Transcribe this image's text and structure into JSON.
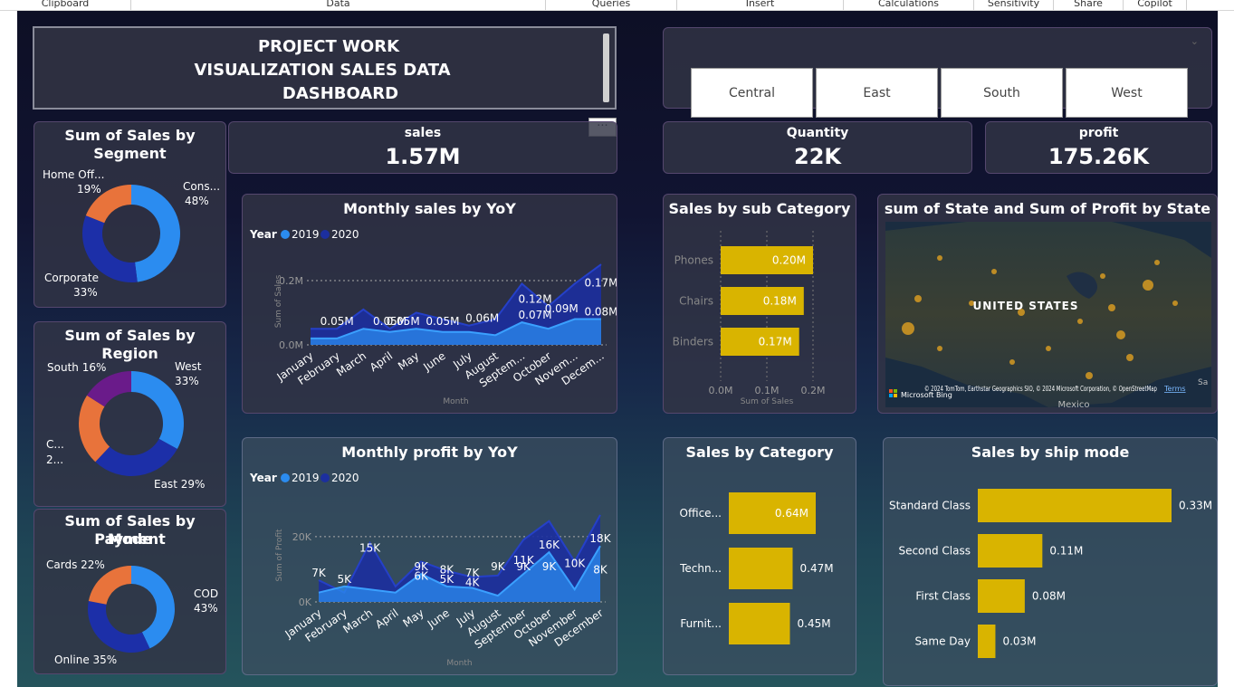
{
  "ribbon": {
    "groups": [
      "Clipboard",
      "Data",
      "Queries",
      "Insert",
      "Calculations",
      "Sensitivity",
      "Share",
      "Copilot"
    ]
  },
  "header": {
    "line1": "PROJECT WORK",
    "line2": "VISUALIZATION SALES DATA",
    "line3": "DASHBOARD"
  },
  "slicer": {
    "options": [
      "Central",
      "East",
      "South",
      "West"
    ]
  },
  "kpis": {
    "sales": {
      "label": "sales",
      "value": "1.57M"
    },
    "quantity": {
      "label": "Quantity",
      "value": "22K"
    },
    "profit": {
      "label": "profit",
      "value": "175.26K"
    }
  },
  "donut_segment": {
    "title_l1": "Sum of Sales by",
    "title_l2": "Segment",
    "slices": [
      {
        "name": "Cons...",
        "pct": "48%",
        "value": 48,
        "color": "#2b8cf0"
      },
      {
        "name": "Corporate",
        "pct": "33%",
        "value": 33,
        "color": "#1c2fa8"
      },
      {
        "name": "Home Off...",
        "pct": "19%",
        "value": 19,
        "color": "#e8733b"
      }
    ]
  },
  "donut_region": {
    "title": "Sum of Sales by Region",
    "slices": [
      {
        "name": "West",
        "pct": "33%",
        "value": 33,
        "color": "#2b8cf0"
      },
      {
        "name": "East",
        "pct": "29%",
        "value": 29,
        "color": "#1c2fa8"
      },
      {
        "name": "C...",
        "pct": "2...",
        "value": 22,
        "color": "#e8733b"
      },
      {
        "name": "South",
        "pct": "16%",
        "value": 16,
        "color": "#6a1b8a"
      }
    ],
    "labels": {
      "west": "West",
      "west_pct": "33%",
      "east": "East 29%",
      "south": "South 16%",
      "c1": "C...",
      "c2": "2..."
    }
  },
  "donut_payment": {
    "title_l1": "Sum of Sales by Payment",
    "title_l2": "Mode",
    "slices": [
      {
        "name": "COD",
        "pct": "43%",
        "value": 43,
        "color": "#2b8cf0"
      },
      {
        "name": "Online",
        "pct": "35%",
        "value": 35,
        "color": "#1c2fa8"
      },
      {
        "name": "Cards",
        "pct": "22%",
        "value": 22,
        "color": "#e8733b"
      }
    ],
    "labels": {
      "cards": "Cards 22%",
      "cod": "COD",
      "cod_pct": "43%",
      "online": "Online 35%"
    }
  },
  "months_sales": [
    "January",
    "February",
    "March",
    "April",
    "May",
    "June",
    "July",
    "August",
    "Septem...",
    "October",
    "Novem...",
    "Decem..."
  ],
  "months_profit": [
    "January",
    "February",
    "March",
    "April",
    "May",
    "June",
    "July",
    "August",
    "September",
    "October",
    "November",
    "December"
  ],
  "chart_data": [
    {
      "type": "area",
      "title": "Monthly sales by YoY",
      "legend_title": "Year",
      "xlabel": "Month",
      "ylabel": "Sum of Sales",
      "yticks": [
        "0.0M",
        "0.2M"
      ],
      "ylim": [
        0,
        0.27
      ],
      "series": [
        {
          "name": "2020",
          "color": "#1c2f9e",
          "values": [
            0.05,
            0.05,
            0.11,
            0.05,
            0.1,
            0.08,
            0.06,
            0.08,
            0.19,
            0.12,
            0.19,
            0.25
          ]
        },
        {
          "name": "2019",
          "color": "#2b8cf0",
          "values": [
            0.02,
            0.02,
            0.05,
            0.04,
            0.05,
            0.04,
            0.04,
            0.03,
            0.07,
            0.05,
            0.08,
            0.08
          ]
        }
      ],
      "data_labels": [
        {
          "text": "0.05M",
          "x": 1,
          "y": 0.05
        },
        {
          "text": "0.05M",
          "x": 3,
          "y": 0.05
        },
        {
          "text": "0.05M",
          "x": 3.5,
          "y": 0.05
        },
        {
          "text": "0.05M",
          "x": 5,
          "y": 0.05
        },
        {
          "text": "0.06M",
          "x": 6.5,
          "y": 0.06
        },
        {
          "text": "0.12M",
          "x": 8.5,
          "y": 0.12
        },
        {
          "text": "0.07M",
          "x": 8.5,
          "y": 0.07
        },
        {
          "text": "0.09M",
          "x": 9.5,
          "y": 0.09
        },
        {
          "text": "0.17M",
          "x": 11,
          "y": 0.17
        },
        {
          "text": "0.08M",
          "x": 11,
          "y": 0.08
        }
      ]
    },
    {
      "type": "area",
      "title": "Monthly profit by YoY",
      "legend_title": "Year",
      "xlabel": "Month",
      "ylabel": "Sum of Profit",
      "yticks": [
        "0K",
        "20K"
      ],
      "ylim": [
        0,
        30000
      ],
      "series": [
        {
          "name": "2020",
          "color": "#1c2f9e",
          "values": [
            7000,
            3000,
            19000,
            5000,
            13000,
            10000,
            8000,
            8500,
            20000,
            26000,
            13000,
            28000
          ]
        },
        {
          "name": "2019",
          "color": "#2b8cf0",
          "values": [
            3000,
            5000,
            4000,
            3000,
            9000,
            5000,
            4500,
            2000,
            9000,
            16000,
            4000,
            18000
          ]
        }
      ],
      "data_labels": [
        {
          "text": "7K",
          "x": 0,
          "y": 7000
        },
        {
          "text": "5K",
          "x": 1,
          "y": 5000
        },
        {
          "text": "15K",
          "x": 2,
          "y": 15000
        },
        {
          "text": "6K",
          "x": 4,
          "y": 6000
        },
        {
          "text": "9K",
          "x": 4,
          "y": 9000
        },
        {
          "text": "8K",
          "x": 5,
          "y": 8000
        },
        {
          "text": "5K",
          "x": 5,
          "y": 5000
        },
        {
          "text": "7K",
          "x": 6,
          "y": 7000
        },
        {
          "text": "4K",
          "x": 6,
          "y": 4000
        },
        {
          "text": "9K",
          "x": 7,
          "y": 9000
        },
        {
          "text": "11K",
          "x": 8,
          "y": 11000
        },
        {
          "text": "9K",
          "x": 8,
          "y": 9000
        },
        {
          "text": "9K",
          "x": 9,
          "y": 9000
        },
        {
          "text": "16K",
          "x": 9,
          "y": 16000
        },
        {
          "text": "10K",
          "x": 10,
          "y": 10000
        },
        {
          "text": "8K",
          "x": 11,
          "y": 8000
        },
        {
          "text": "18K",
          "x": 11,
          "y": 18000
        }
      ]
    },
    {
      "type": "bar",
      "title": "Sales by sub Category",
      "xlabel": "Sum of Sales",
      "xticks": [
        "0.0M",
        "0.1M",
        "0.2M"
      ],
      "xlim": [
        0,
        0.2
      ],
      "categories": [
        "Phones",
        "Chairs",
        "Binders"
      ],
      "values": [
        0.2,
        0.18,
        0.17
      ],
      "value_labels": [
        "0.20M",
        "0.18M",
        "0.17M"
      ],
      "color": "#d9b400"
    },
    {
      "type": "bar",
      "title": "Sales by Category",
      "categories": [
        "Office...",
        "Techn...",
        "Furnit..."
      ],
      "values": [
        0.64,
        0.47,
        0.45
      ],
      "value_labels": [
        "0.64M",
        "0.47M",
        "0.45M"
      ],
      "xlim": [
        0,
        0.64
      ],
      "color": "#d9b400"
    },
    {
      "type": "bar",
      "title": "Sales by ship mode",
      "categories": [
        "Standard Class",
        "Second Class",
        "First Class",
        "Same Day"
      ],
      "values": [
        0.33,
        0.11,
        0.08,
        0.03
      ],
      "value_labels": [
        "0.33M",
        "0.11M",
        "0.08M",
        "0.03M"
      ],
      "xlim": [
        0,
        0.33
      ],
      "color": "#d9b400"
    }
  ],
  "map": {
    "title": "sum of State and Sum of Profit by State",
    "country": "UNITED STATES",
    "mexico": "Mexico",
    "provider": "Microsoft Bing",
    "copyright": "© 2024 TomTom, Earthstar Geographics SIO, © 2024 Microsoft Corporation, © OpenStreetMap",
    "terms": "Terms",
    "edge": "Sa"
  },
  "more_options": "···"
}
